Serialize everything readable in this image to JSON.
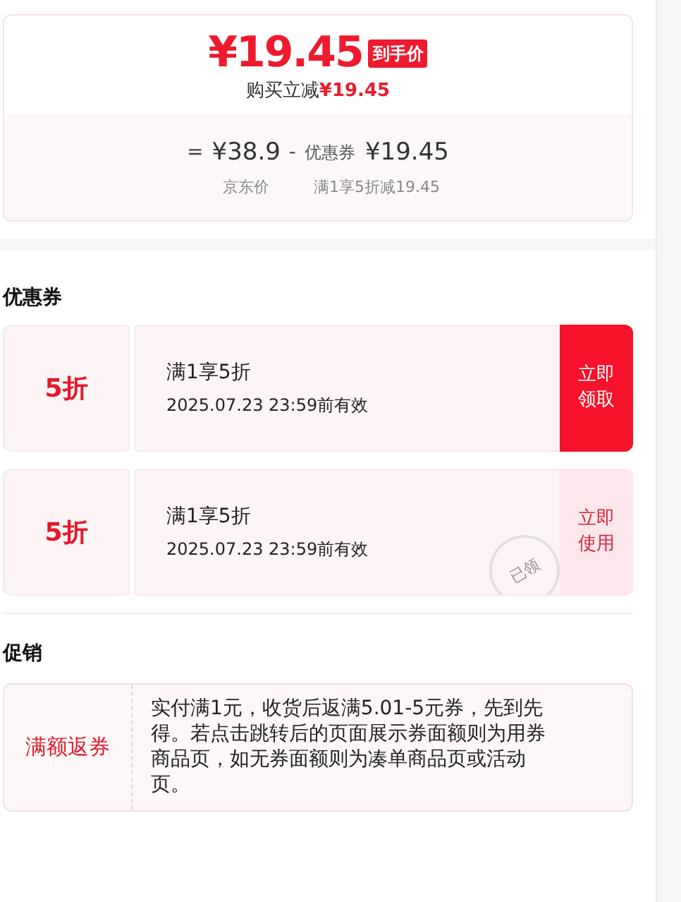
{
  "price": {
    "amount": "¥19.45",
    "tag": "到手价",
    "saving_label": "购买立减",
    "saving_amount": "¥19.45"
  },
  "breakdown": {
    "equals": "=",
    "list_price": "¥38.9",
    "list_label": "京东价",
    "minus": "-",
    "coupon_prefix": "优惠券",
    "coupon_value": "¥19.45",
    "coupon_label": "满1享5折减19.45"
  },
  "coupons_title": "优惠券",
  "coupons": [
    {
      "discount": "5折",
      "condition": "满1享5折",
      "validity": "2025.07.23 23:59前有效",
      "action": "立即领取",
      "claimed": false
    },
    {
      "discount": "5折",
      "condition": "满1享5折",
      "validity": "2025.07.23 23:59前有效",
      "action": "立即使用",
      "claimed": true,
      "stamp": "已领"
    }
  ],
  "promotions_title": "促销",
  "promotions": [
    {
      "tag": "满额返券",
      "text": "实付满1元，收货后返满5.01-5元券，先到先得。若点击跳转后的页面展示券面额则为用券商品页，如无券面额则为凑单商品页或活动页。"
    }
  ]
}
